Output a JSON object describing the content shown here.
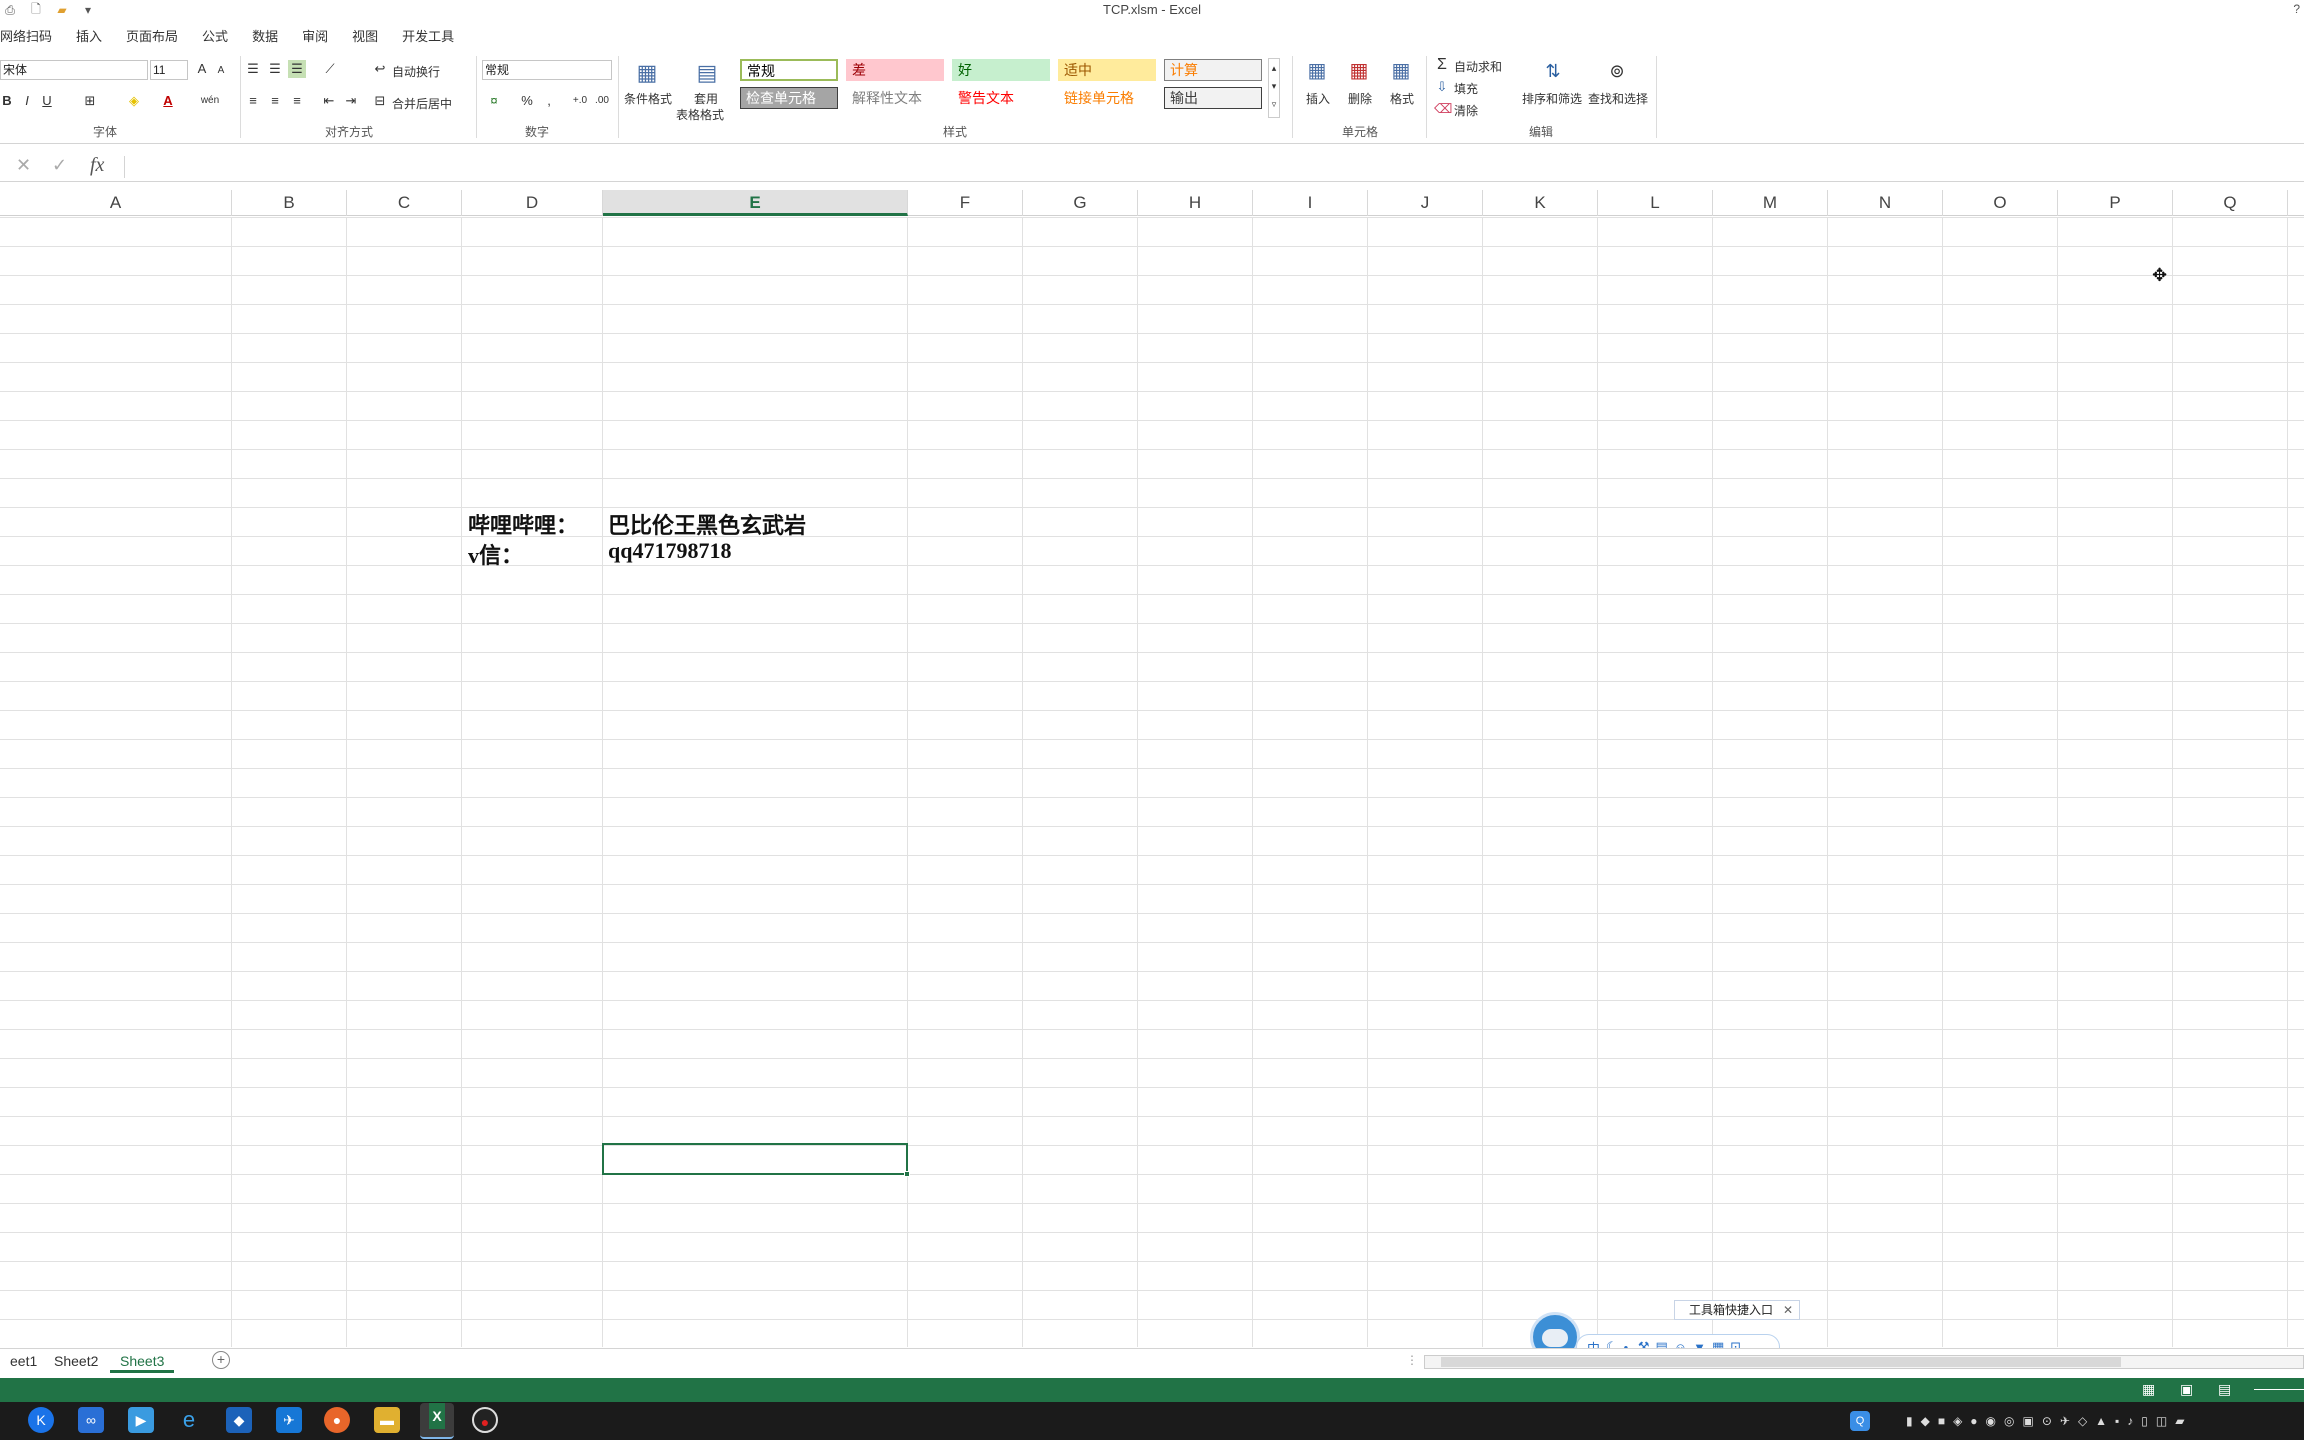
{
  "window": {
    "title": "TCP.xlsm - Excel",
    "help": "?"
  },
  "qat": {
    "icons": [
      "print-preview-icon",
      "new-file-icon",
      "open-folder-icon",
      "customize-icon"
    ]
  },
  "ribbon_tabs": [
    "网络扫码",
    "插入",
    "页面布局",
    "公式",
    "数据",
    "审阅",
    "视图",
    "开发工具"
  ],
  "font_group": {
    "font_name": "宋体",
    "font_size": "11",
    "grow": "A",
    "shrink": "A",
    "bold": "B",
    "italic": "I",
    "underline": "U",
    "label": "字体",
    "wen": "wén"
  },
  "align_group": {
    "wrap_text": "自动换行",
    "merge_center": "合并后居中",
    "label": "对齐方式"
  },
  "number_group": {
    "format": "常规",
    "percent": "%",
    "comma": ",",
    "label": "数字"
  },
  "styles_group": {
    "conditional_format": "条件格式",
    "table_format_1": "套用",
    "table_format_2": "表格格式",
    "label": "样式",
    "cells": [
      {
        "text": "常规",
        "bg": "#ffffff",
        "color": "#000000",
        "border": "#9bbb59"
      },
      {
        "text": "差",
        "bg": "#ffc7ce",
        "color": "#9c0006",
        "border": "#ffc7ce"
      },
      {
        "text": "好",
        "bg": "#c6efce",
        "color": "#006100",
        "border": "#c6efce"
      },
      {
        "text": "适中",
        "bg": "#ffeb9c",
        "color": "#9c5700",
        "border": "#ffeb9c"
      },
      {
        "text": "计算",
        "bg": "#f2f2f2",
        "color": "#fa7d00",
        "border": "#7f7f7f"
      },
      {
        "text": "检查单元格",
        "bg": "#a5a5a5",
        "color": "#ffffff",
        "border": "#3f3f3f"
      },
      {
        "text": "解释性文本",
        "bg": "#ffffff",
        "color": "#7f7f7f",
        "border": "#ffffff"
      },
      {
        "text": "警告文本",
        "bg": "#ffffff",
        "color": "#ff0000",
        "border": "#ffffff"
      },
      {
        "text": "链接单元格",
        "bg": "#ffffff",
        "color": "#fa7d00",
        "border": "#ffffff"
      },
      {
        "text": "输出",
        "bg": "#f2f2f2",
        "color": "#3f3f3f",
        "border": "#3f3f3f"
      }
    ]
  },
  "cells_group": {
    "insert": "插入",
    "delete": "删除",
    "format": "格式",
    "label": "单元格"
  },
  "edit_group": {
    "autosum": "自动求和",
    "fill": "填充",
    "clear": "清除",
    "sort_filter": "排序和筛选",
    "find_select": "查找和选择",
    "label": "编辑"
  },
  "formula_bar": {
    "cancel": "✕",
    "enter": "✓",
    "fx": "fx",
    "value": ""
  },
  "columns": [
    "A",
    "B",
    "C",
    "D",
    "E",
    "F",
    "G",
    "H",
    "I",
    "J",
    "K",
    "L",
    "M",
    "N",
    "O",
    "P",
    "Q"
  ],
  "selected_column": "E",
  "cells": {
    "d_row1": "哔哩哔哩：",
    "e_row1": "巴比伦王黑色玄武岩",
    "d_row2": "v信：",
    "e_row2": "qq471798718"
  },
  "sheets": [
    "eet1",
    "Sheet2",
    "Sheet3"
  ],
  "active_sheet": "Sheet3",
  "widget": {
    "tip": "工具箱快捷入口",
    "close": "✕"
  },
  "accent": "#217346"
}
